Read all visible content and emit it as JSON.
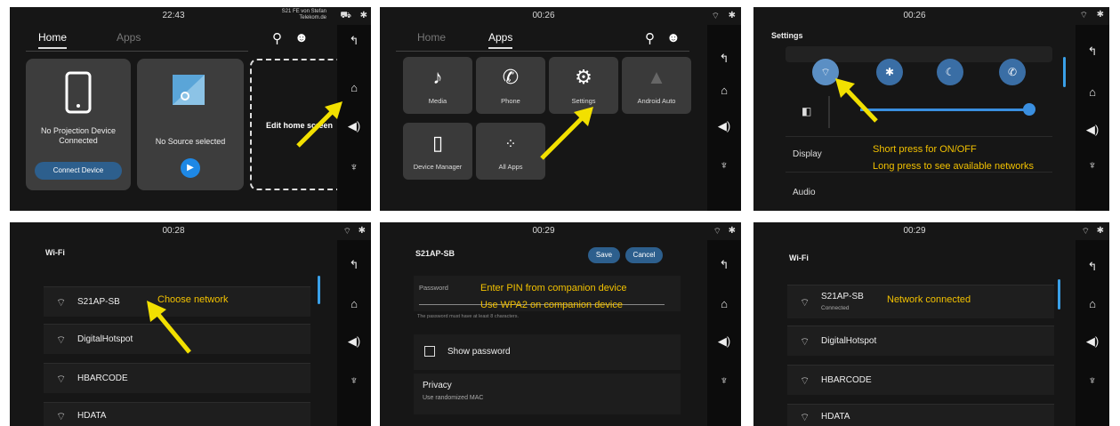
{
  "panel1": {
    "clock": "22:43",
    "carrier": [
      "S21 FE von Stefan",
      "Telekom.de"
    ],
    "tabs": [
      "Home",
      "Apps"
    ],
    "card1_text": [
      "No Projection Device",
      "Connected"
    ],
    "connect_button": "Connect Device",
    "card2_text": "No Source selected",
    "edit_label": "Edit home screen"
  },
  "panel2": {
    "clock": "00:26",
    "tabs": [
      "Home",
      "Apps"
    ],
    "apps": [
      "Media",
      "Phone",
      "Settings",
      "Android Auto",
      "Device Manager",
      "All Apps"
    ]
  },
  "panel3": {
    "clock": "00:26",
    "title": "Settings",
    "items": [
      "Display",
      "Audio"
    ],
    "annotation": [
      "Short press for ON/OFF",
      "Long press to see available networks"
    ]
  },
  "panel4": {
    "clock": "00:28",
    "title": "Wi-Fi",
    "networks": [
      "S21AP-SB",
      "DigitalHotspot",
      "HBARCODE",
      "HDATA"
    ],
    "annotation": "Choose network"
  },
  "panel5": {
    "clock": "00:29",
    "title": "S21AP-SB",
    "save": "Save",
    "cancel": "Cancel",
    "password_label": "Password",
    "hint": "The password must have at least 8 characters.",
    "show_password": "Show password",
    "privacy": "Privacy",
    "privacy_sub": "Use randomized MAC",
    "annotation": [
      "Enter PIN from companion device",
      "Use WPA2 on companion device"
    ]
  },
  "panel6": {
    "clock": "00:29",
    "title": "Wi-Fi",
    "networks": [
      "S21AP-SB",
      "DigitalHotspot",
      "HBARCODE",
      "HDATA"
    ],
    "connected": "Connected",
    "annotation": "Network connected"
  },
  "icons": {
    "back": "↰",
    "home": "⌂",
    "volume": "◀)",
    "mic": "🎤",
    "wifi": "⌔",
    "bluetooth": "✱",
    "search": "⚲",
    "account": "☻"
  },
  "colors": {
    "annotation": "#f2c100",
    "accent": "#3a6ea5",
    "panel_bg": "#161616"
  }
}
